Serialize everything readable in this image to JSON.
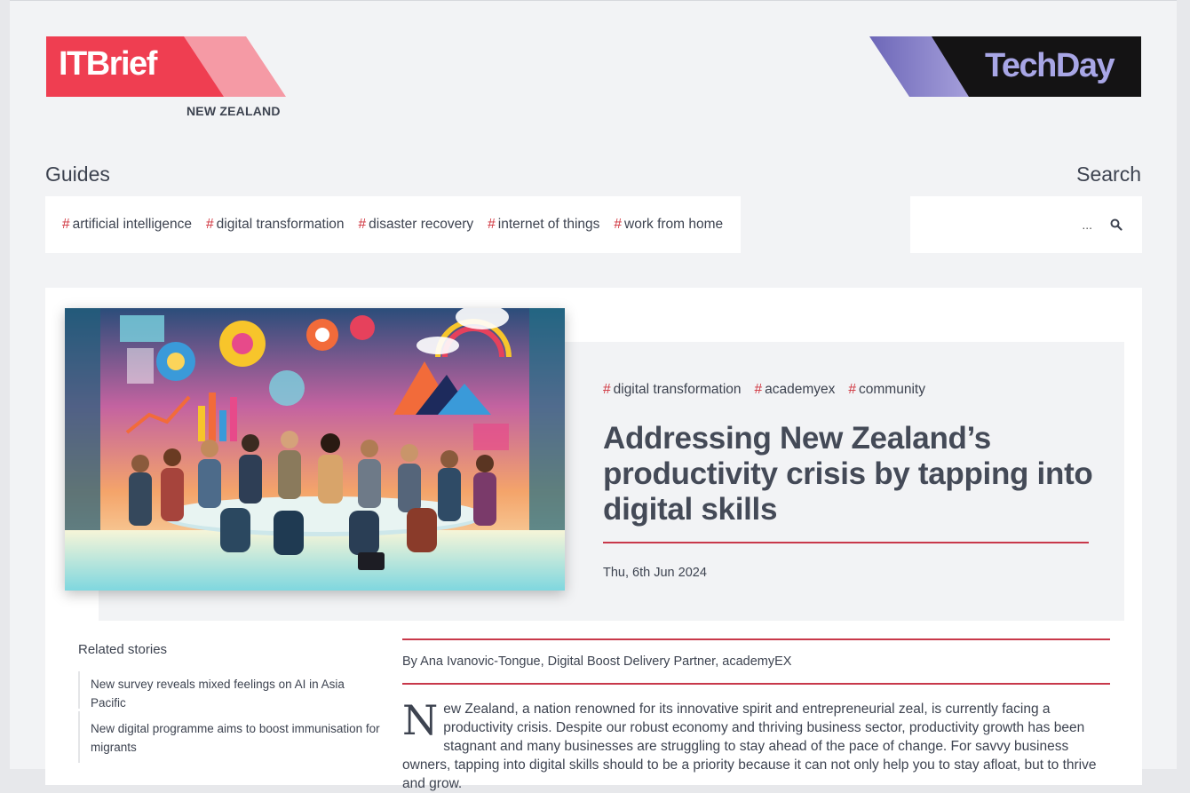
{
  "header": {
    "brand_left": "ITBrief",
    "brand_left_region": "NEW ZEALAND",
    "brand_right": "TechDay"
  },
  "guides": {
    "title": "Guides",
    "tags": [
      "artificial intelligence",
      "digital transformation",
      "disaster recovery",
      "internet of things",
      "work from home"
    ]
  },
  "search": {
    "title": "Search",
    "placeholder": "..."
  },
  "article": {
    "tags": [
      "digital transformation",
      "academyex",
      "community"
    ],
    "headline": "Addressing New Zealand’s productivity crisis by tapping into digital skills",
    "date": "Thu, 6th Jun 2024",
    "byline": "By Ana Ivanovic-Tongue, Digital Boost Delivery Partner, academyEX",
    "dropcap": "N",
    "body": "ew Zealand, a nation renowned for its innovative spirit and entrepreneurial zeal, is currently facing a productivity crisis. Despite our robust economy and thriving business sector, productivity growth has been stagnant and many businesses are struggling to stay ahead of the pace of change. For savvy business owners, tapping into digital skills should to be a priority because it can not only help you to stay afloat, but to thrive and grow."
  },
  "related": {
    "title": "Related stories",
    "items": [
      "New survey reveals mixed feelings on AI in Asia Pacific",
      "New digital programme aims to boost immunisation for migrants"
    ]
  },
  "colors": {
    "accent": "#d0353f",
    "rule": "#c8384a",
    "itbrief_red": "#ef3e51",
    "itbrief_pink": "#f59aa5",
    "techday_purple": "#8a86c9",
    "techday_dark": "#141314"
  }
}
